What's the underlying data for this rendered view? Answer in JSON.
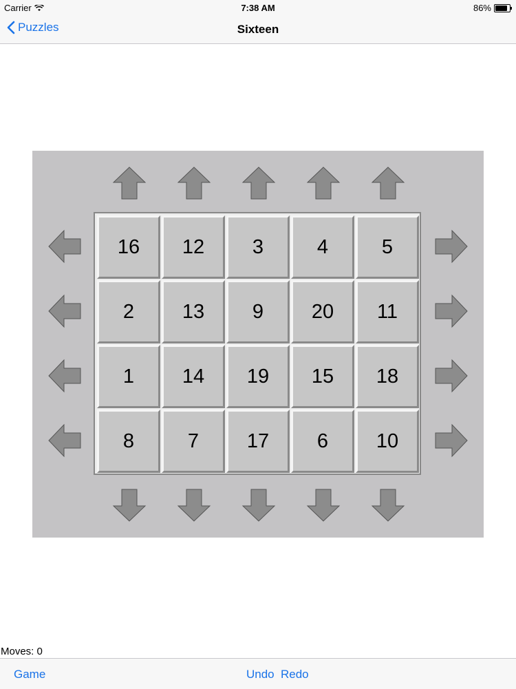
{
  "status_bar": {
    "carrier": "Carrier",
    "time": "7:38 AM",
    "battery": "86%",
    "battery_level": 0.86
  },
  "nav": {
    "back_label": "Puzzles",
    "title": "Sixteen"
  },
  "puzzle": {
    "grid": [
      [
        16,
        12,
        3,
        4,
        5
      ],
      [
        2,
        13,
        9,
        20,
        11
      ],
      [
        1,
        14,
        19,
        15,
        18
      ],
      [
        8,
        7,
        17,
        6,
        10
      ]
    ]
  },
  "moves_label": "Moves: 0",
  "toolbar": {
    "game_label": "Game",
    "undo_label": "Undo",
    "redo_label": "Redo"
  },
  "colors": {
    "accent": "#1a73e8",
    "board_bg": "#c4c3c5",
    "tile_bg": "#c6c6c6",
    "arrow_fill": "#8c8c8c"
  }
}
